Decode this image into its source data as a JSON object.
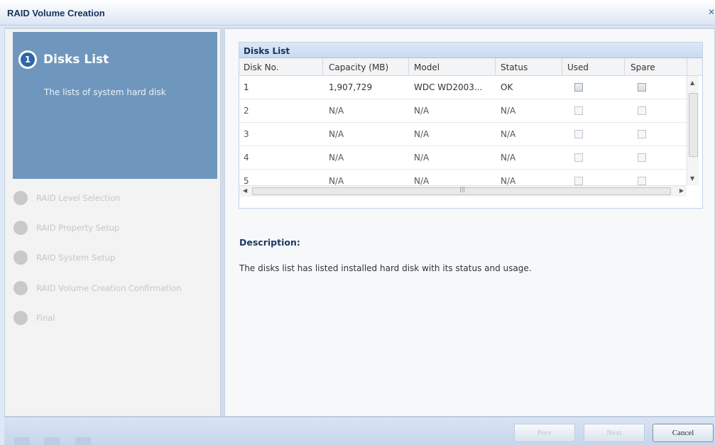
{
  "window": {
    "title": "RAID Volume Creation"
  },
  "wizard": {
    "active_step": {
      "number": "1",
      "title": "Disks List",
      "description": "The lists of system hard disk"
    },
    "steps": [
      {
        "label": "RAID Level Selection"
      },
      {
        "label": "RAID Property Setup"
      },
      {
        "label": "RAID System Setup"
      },
      {
        "label": "RAID Volume Creation Confirmation"
      },
      {
        "label": "Final"
      }
    ]
  },
  "disks_grid": {
    "title": "Disks List",
    "columns": [
      "Disk No.",
      "Capacity (MB)",
      "Model",
      "Status",
      "Used",
      "Spare"
    ],
    "rows": [
      {
        "disk_no": "1",
        "capacity": "1,907,729",
        "model": "WDC WD2003...",
        "status": "OK",
        "used": false,
        "spare": false,
        "enabled": true
      },
      {
        "disk_no": "2",
        "capacity": "N/A",
        "model": "N/A",
        "status": "N/A",
        "used": false,
        "spare": false,
        "enabled": false
      },
      {
        "disk_no": "3",
        "capacity": "N/A",
        "model": "N/A",
        "status": "N/A",
        "used": false,
        "spare": false,
        "enabled": false
      },
      {
        "disk_no": "4",
        "capacity": "N/A",
        "model": "N/A",
        "status": "N/A",
        "used": false,
        "spare": false,
        "enabled": false
      },
      {
        "disk_no": "5",
        "capacity": "N/A",
        "model": "N/A",
        "status": "N/A",
        "used": false,
        "spare": false,
        "enabled": false
      }
    ]
  },
  "description": {
    "heading": "Description:",
    "text": "The disks list has listed installed hard disk with its status and usage."
  },
  "buttons": {
    "prev": "Prev",
    "next": "Next",
    "cancel": "Cancel"
  },
  "colors": {
    "active_step_bg": "#6f97bd",
    "title_text": "#15335c"
  }
}
